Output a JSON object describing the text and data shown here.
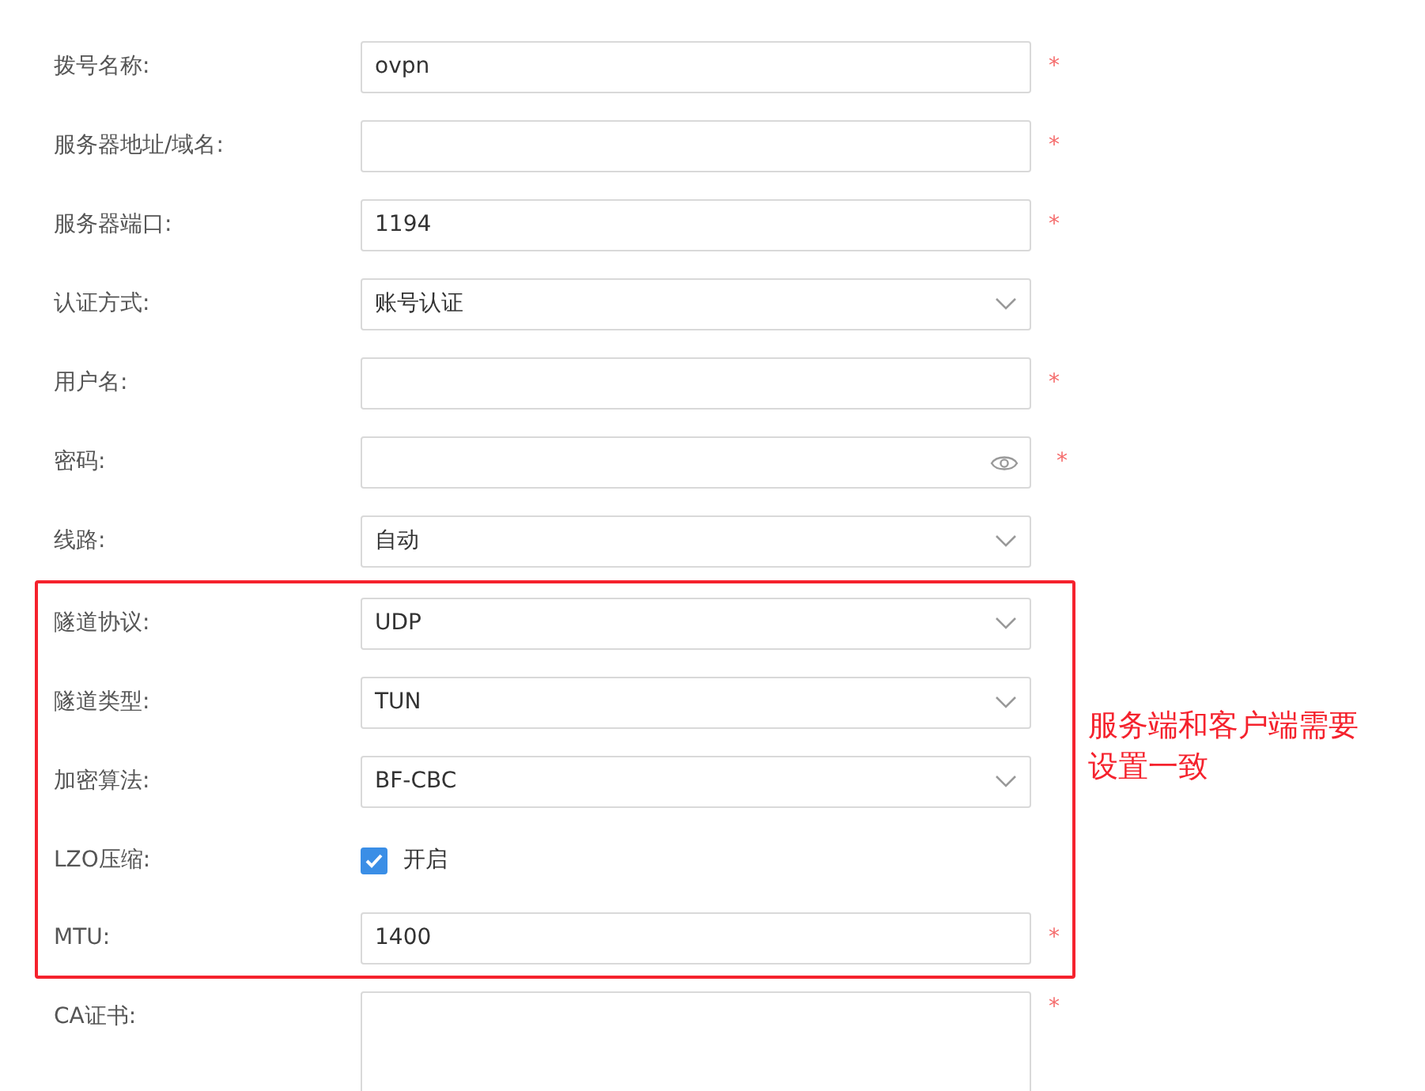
{
  "sections": [
    {
      "kind": "plain",
      "fields": [
        {
          "kind": "text",
          "label": "拨号名称:",
          "value": "ovpn",
          "required_mark": "*"
        },
        {
          "kind": "text",
          "label": "服务器地址/域名:",
          "required_mark": "*"
        },
        {
          "kind": "text",
          "label": "服务器端口:",
          "value": "1194",
          "required_mark": "*"
        },
        {
          "kind": "select",
          "label": "认证方式:",
          "value": "账号认证"
        },
        {
          "kind": "text",
          "label": "用户名:",
          "required_mark": "*"
        },
        {
          "kind": "password",
          "label": "密码:",
          "required_mark": "*"
        },
        {
          "kind": "select",
          "label": "线路:",
          "value": "自动"
        }
      ]
    },
    {
      "kind": "highlight",
      "note": "服务端和客户端需要设置一致",
      "fields": [
        {
          "kind": "select",
          "label": "隧道协议:",
          "value": "UDP"
        },
        {
          "kind": "select",
          "label": "隧道类型:",
          "value": "TUN"
        },
        {
          "kind": "select",
          "label": "加密算法:",
          "value": "BF-CBC"
        },
        {
          "kind": "checkbox",
          "label": "LZO压缩:",
          "option": "开启",
          "checked": true
        },
        {
          "kind": "text",
          "label": "MTU:",
          "value": "1400",
          "required_mark": "*"
        }
      ]
    },
    {
      "kind": "plain",
      "fields": [
        {
          "kind": "textarea",
          "label": "CA证书:",
          "required_mark": "*"
        }
      ]
    }
  ]
}
